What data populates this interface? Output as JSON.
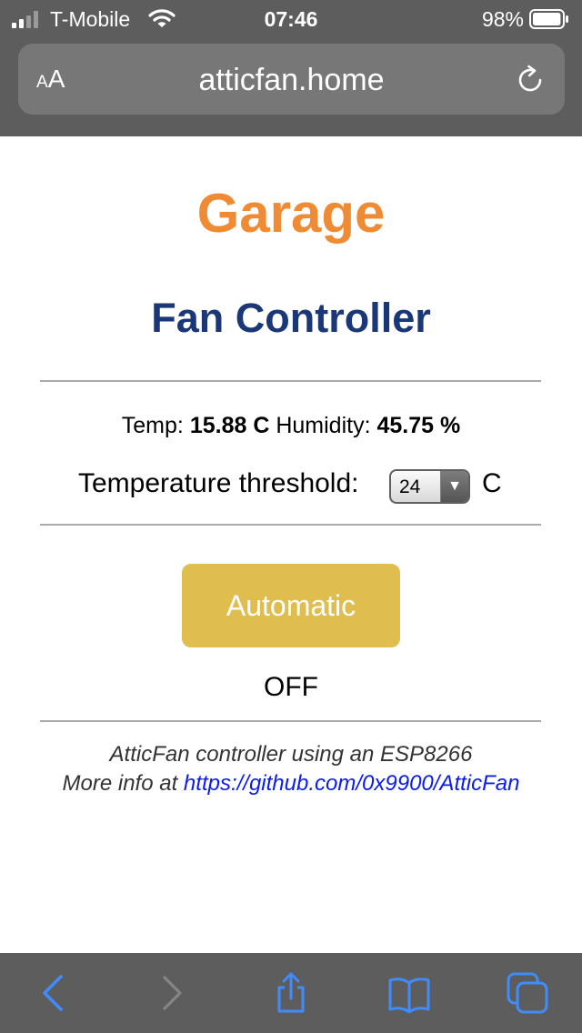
{
  "status_bar": {
    "carrier": "T-Mobile",
    "time": "07:46",
    "battery": "98%",
    "battery_level": 0.98
  },
  "browser": {
    "text_size_small": "A",
    "text_size_large": "A",
    "url": "atticfan.home"
  },
  "page": {
    "title": "Garage",
    "subtitle": "Fan Controller",
    "readings": {
      "temp_label": "Temp:",
      "temp_value": "15.88 C",
      "humidity_label": "Humidity:",
      "humidity_value": "45.75 %"
    },
    "threshold": {
      "label": "Temperature threshold:",
      "selected": "24",
      "unit": "C"
    },
    "button_label": "Automatic",
    "state": "OFF",
    "footer": {
      "line1": "AtticFan controller using an ESP8266",
      "line2_prefix": "More info at",
      "link_text": "https://github.com/0x9900/AtticFan"
    }
  },
  "toolbar": {
    "items": [
      "back-icon",
      "forward-icon",
      "share-icon",
      "bookmarks-icon",
      "tabs-icon"
    ]
  },
  "colors": {
    "chrome": "#5d5d5d",
    "url_field": "#777777",
    "title": "#ef8b35",
    "subtitle": "#1a3777",
    "button": "#dfbd4e",
    "link": "#0a1cf2",
    "toolbar_icon_active": "#3f8cff",
    "toolbar_icon_disabled": "#858585"
  }
}
